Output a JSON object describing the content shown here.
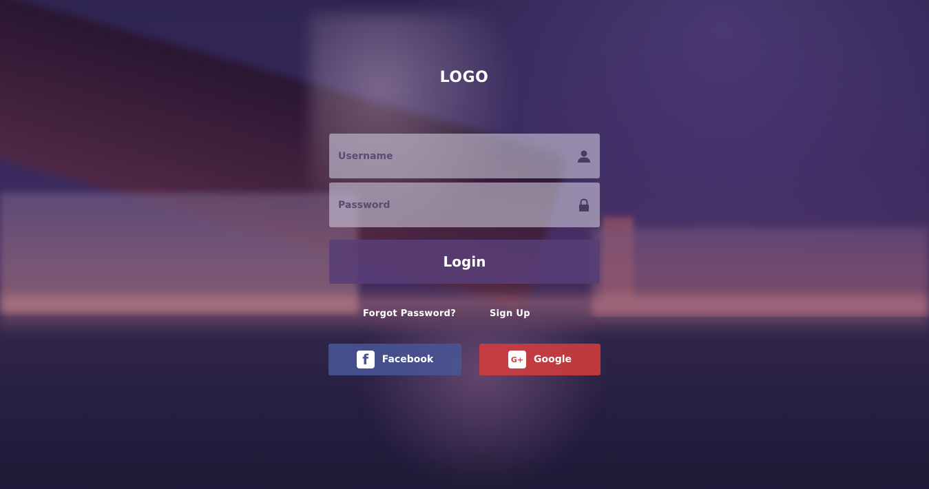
{
  "logo": {
    "text": "LOGO"
  },
  "form": {
    "username_placeholder": "Username",
    "password_placeholder": "Password",
    "login_label": "Login"
  },
  "links": {
    "forgot_password": "Forgot Password?",
    "sign_up": "Sign Up"
  },
  "social": {
    "facebook_label": "Facebook",
    "facebook_glyph": "f",
    "google_label": "Google",
    "google_glyph": "G+"
  },
  "icons": {
    "username": "user-icon",
    "password": "lock-icon",
    "facebook": "facebook-icon",
    "google": "google-plus-icon"
  },
  "colors": {
    "login_button": "#583e76",
    "facebook": "#485696",
    "google": "#d23c3c"
  }
}
